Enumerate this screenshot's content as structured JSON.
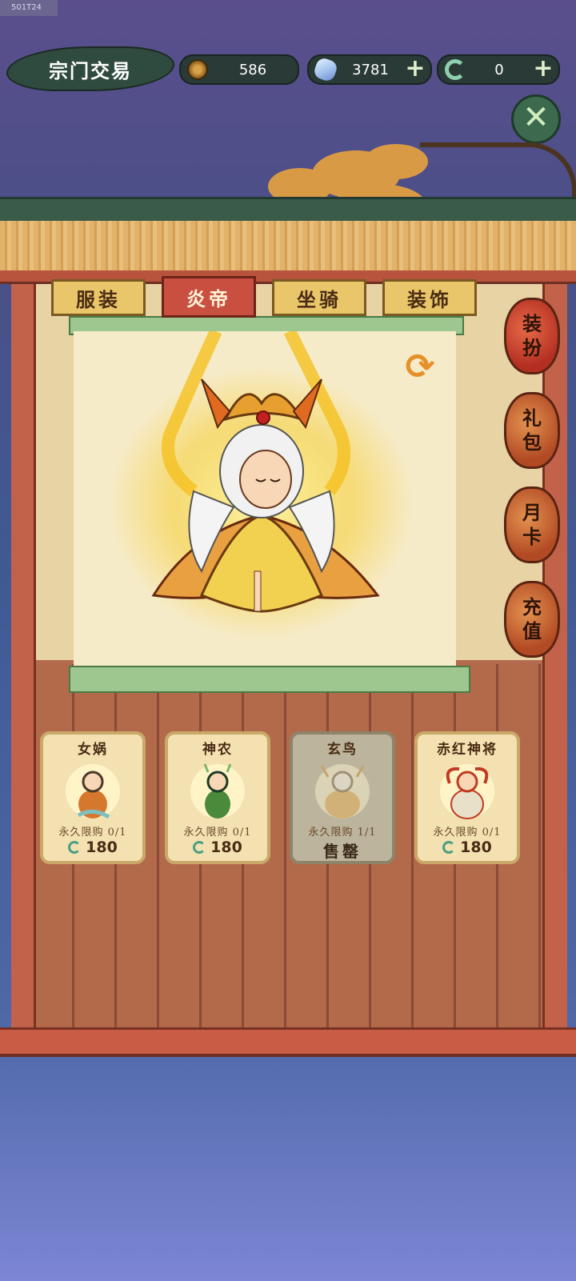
{
  "watermark": "501T24",
  "header": {
    "title": "宗门交易",
    "copper": "586",
    "jade": "3781",
    "token": "0",
    "plus": "+",
    "close": "✕"
  },
  "tabs": [
    {
      "label": "服装",
      "active": false
    },
    {
      "label": "炎帝",
      "active": true
    },
    {
      "label": "坐骑",
      "active": false
    },
    {
      "label": "装饰",
      "active": false
    }
  ],
  "side_menu": [
    {
      "top": "装",
      "bottom": "扮"
    },
    {
      "top": "礼",
      "bottom": "包"
    },
    {
      "top": "月",
      "bottom": "卡"
    },
    {
      "top": "充",
      "bottom": "值"
    }
  ],
  "refresh_icon": "⟳",
  "cards": [
    {
      "name": "女娲",
      "limit": "永久限购 0/1",
      "price": "180",
      "sold": false,
      "colors": [
        "#4b3a2a",
        "#d6772e",
        "#7cc0c0"
      ]
    },
    {
      "name": "神农",
      "limit": "永久限购 0/1",
      "price": "180",
      "sold": false,
      "colors": [
        "#1e3a26",
        "#4a8a3a",
        "#e6c27a"
      ]
    },
    {
      "name": "玄鸟",
      "limit": "永久限购 1/1",
      "price": "售罄",
      "sold": true,
      "colors": [
        "#e8e0d0",
        "#e0b060",
        "#c99a50"
      ]
    },
    {
      "name": "赤红神将",
      "limit": "永久限购 0/1",
      "price": "180",
      "sold": false,
      "colors": [
        "#c23a22",
        "#f0c04a",
        "#e8e0c8"
      ]
    }
  ]
}
